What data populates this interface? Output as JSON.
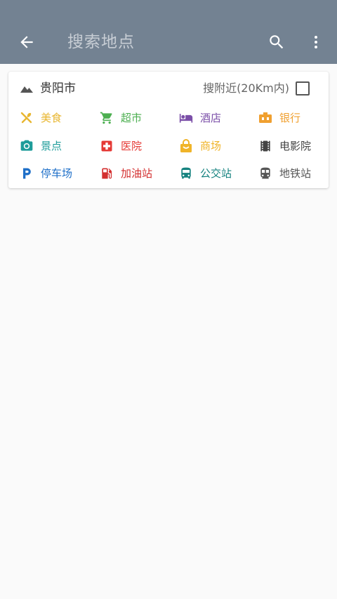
{
  "appbar": {
    "title": "搜索地点"
  },
  "card": {
    "city": "贵阳市",
    "nearby_label": "搜附近(20Km内)",
    "nearby_checked": false
  },
  "categories": [
    {
      "label": "美食",
      "color": "#e8b630",
      "icon": "fork-knife-icon"
    },
    {
      "label": "超市",
      "color": "#4caf50",
      "icon": "shopping-cart-icon"
    },
    {
      "label": "酒店",
      "color": "#7b4fa8",
      "icon": "hotel-bed-icon"
    },
    {
      "label": "银行",
      "color": "#f0a030",
      "icon": "bank-icon"
    },
    {
      "label": "景点",
      "color": "#1e9c9a",
      "icon": "camera-icon"
    },
    {
      "label": "医院",
      "color": "#e53935",
      "icon": "medical-cross-icon"
    },
    {
      "label": "商场",
      "color": "#f0b429",
      "icon": "shopping-bag-icon"
    },
    {
      "label": "电影院",
      "color": "#444444",
      "icon": "film-icon"
    },
    {
      "label": "停车场",
      "color": "#1e6fc8",
      "icon": "parking-icon"
    },
    {
      "label": "加油站",
      "color": "#d32f2f",
      "icon": "gas-station-icon"
    },
    {
      "label": "公交站",
      "color": "#15827f",
      "icon": "bus-icon"
    },
    {
      "label": "地铁站",
      "color": "#555555",
      "icon": "subway-icon"
    }
  ]
}
